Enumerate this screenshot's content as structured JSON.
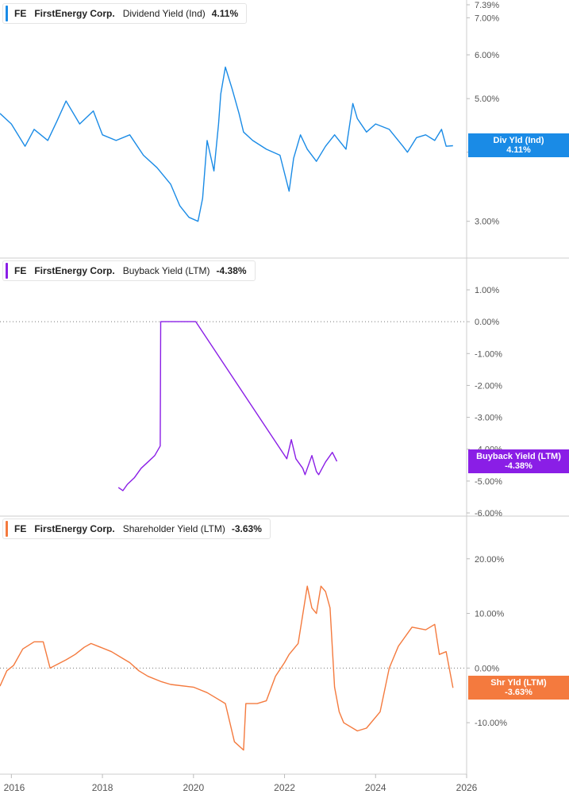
{
  "chart_data": [
    {
      "type": "line",
      "legend": {
        "ticker": "FE",
        "company": "FirstEnergy Corp.",
        "metric": "Dividend Yield (Ind)",
        "value": "4.11%"
      },
      "color": "#1a8be6",
      "badge": {
        "line1": "Div Yld (Ind)",
        "line2": "4.11%"
      },
      "scale": "log",
      "ylim": [
        2.6,
        7.39
      ],
      "yticks": [
        {
          "v": 7.39,
          "label": "7.39%"
        },
        {
          "v": 7.0,
          "label": "7.00%"
        },
        {
          "v": 6.0,
          "label": "6.00%"
        },
        {
          "v": 5.0,
          "label": "5.00%"
        },
        {
          "v": 4.0,
          "label": "4.00%"
        },
        {
          "v": 3.0,
          "label": "3.00%"
        }
      ],
      "x": [
        2015.75,
        2016.0,
        2016.3,
        2016.5,
        2016.8,
        2017.0,
        2017.2,
        2017.5,
        2017.8,
        2018.0,
        2018.3,
        2018.6,
        2018.9,
        2019.2,
        2019.5,
        2019.7,
        2019.9,
        2020.1,
        2020.2,
        2020.3,
        2020.45,
        2020.55,
        2020.6,
        2020.7,
        2020.85,
        2021.0,
        2021.1,
        2021.3,
        2021.6,
        2021.9,
        2022.1,
        2022.2,
        2022.35,
        2022.5,
        2022.7,
        2022.9,
        2023.1,
        2023.35,
        2023.5,
        2023.6,
        2023.8,
        2024.0,
        2024.3,
        2024.6,
        2024.7,
        2024.9,
        2025.1,
        2025.3,
        2025.45,
        2025.55,
        2025.7
      ],
      "y": [
        4.7,
        4.5,
        4.1,
        4.4,
        4.2,
        4.55,
        4.95,
        4.5,
        4.75,
        4.3,
        4.2,
        4.3,
        3.95,
        3.75,
        3.5,
        3.2,
        3.05,
        3.0,
        3.3,
        4.2,
        3.7,
        4.5,
        5.1,
        5.7,
        5.2,
        4.7,
        4.35,
        4.2,
        4.05,
        3.95,
        3.4,
        3.9,
        4.3,
        4.05,
        3.85,
        4.1,
        4.3,
        4.05,
        4.9,
        4.6,
        4.35,
        4.5,
        4.4,
        4.1,
        4.0,
        4.25,
        4.3,
        4.2,
        4.4,
        4.1,
        4.11
      ],
      "last_value": 4.11
    },
    {
      "type": "line",
      "legend": {
        "ticker": "FE",
        "company": "FirstEnergy Corp.",
        "metric": "Buyback Yield (LTM)",
        "value": "-4.38%"
      },
      "color": "#8a1ee6",
      "badge": {
        "line1": "Buyback Yield (LTM)",
        "line2": "-4.38%"
      },
      "scale": "linear",
      "ylim": [
        -6.0,
        1.0
      ],
      "yticks": [
        {
          "v": 1.0,
          "label": "1.00%"
        },
        {
          "v": 0.0,
          "label": "0.00%"
        },
        {
          "v": -1.0,
          "label": "-1.00%"
        },
        {
          "v": -2.0,
          "label": "-2.00%"
        },
        {
          "v": -3.0,
          "label": "-3.00%"
        },
        {
          "v": -4.0,
          "label": "-4.00%"
        },
        {
          "v": -5.0,
          "label": "-5.00%"
        },
        {
          "v": -6.0,
          "label": "-6.00%"
        }
      ],
      "zero_line": true,
      "x": [
        2018.35,
        2018.45,
        2018.55,
        2018.7,
        2018.85,
        2019.0,
        2019.15,
        2019.27,
        2019.28,
        2020.05,
        2022.05,
        2022.15,
        2022.25,
        2022.4,
        2022.45,
        2022.6,
        2022.7,
        2022.75,
        2022.9,
        2023.05,
        2023.15
      ],
      "y": [
        -5.2,
        -5.3,
        -5.1,
        -4.9,
        -4.6,
        -4.4,
        -4.2,
        -3.9,
        0.0,
        0.0,
        -4.3,
        -3.7,
        -4.3,
        -4.6,
        -4.8,
        -4.2,
        -4.7,
        -4.8,
        -4.4,
        -4.1,
        -4.38
      ],
      "last_value": -4.38
    },
    {
      "type": "line",
      "legend": {
        "ticker": "FE",
        "company": "FirstEnergy Corp.",
        "metric": "Shareholder Yield (LTM)",
        "value": "-3.63%"
      },
      "color": "#f47a3e",
      "badge": {
        "line1": "Shr Yld (LTM)",
        "line2": "-3.63%"
      },
      "scale": "linear",
      "ylim": [
        -15.5,
        22.0
      ],
      "yticks": [
        {
          "v": 20.0,
          "label": "20.00%"
        },
        {
          "v": 10.0,
          "label": "10.00%"
        },
        {
          "v": 0.0,
          "label": "0.00%"
        },
        {
          "v": -10.0,
          "label": "-10.00%"
        }
      ],
      "zero_line": true,
      "x": [
        2015.75,
        2015.9,
        2016.05,
        2016.25,
        2016.5,
        2016.7,
        2016.85,
        2017.2,
        2017.4,
        2017.6,
        2017.75,
        2017.9,
        2018.2,
        2018.4,
        2018.6,
        2018.8,
        2019.0,
        2019.3,
        2019.5,
        2020.0,
        2020.3,
        2020.5,
        2020.7,
        2020.9,
        2021.1,
        2021.15,
        2021.2,
        2021.4,
        2021.6,
        2021.8,
        2022.0,
        2022.1,
        2022.3,
        2022.5,
        2022.6,
        2022.7,
        2022.8,
        2022.9,
        2023.0,
        2023.1,
        2023.2,
        2023.3,
        2023.6,
        2023.8,
        2024.1,
        2024.3,
        2024.5,
        2024.8,
        2025.1,
        2025.3,
        2025.4,
        2025.55,
        2025.7
      ],
      "y": [
        -3.3,
        -0.5,
        0.5,
        3.5,
        4.8,
        4.8,
        0.0,
        1.5,
        2.5,
        3.8,
        4.5,
        4.0,
        3.0,
        2.0,
        1.0,
        -0.5,
        -1.5,
        -2.5,
        -3.0,
        -3.5,
        -4.5,
        -5.5,
        -6.5,
        -13.5,
        -15.0,
        -6.5,
        -6.5,
        -6.5,
        -6.0,
        -1.5,
        1.0,
        2.5,
        4.5,
        15.0,
        11.0,
        10.0,
        15.0,
        14.0,
        11.0,
        -3.5,
        -8.0,
        -10.0,
        -11.5,
        -11.0,
        -8.0,
        0.0,
        4.0,
        7.5,
        7.0,
        8.0,
        2.5,
        3.0,
        -3.63
      ],
      "last_value": -3.63
    }
  ],
  "x_axis": {
    "range": [
      2015.75,
      2026.0
    ],
    "ticks": [
      {
        "v": 2016,
        "label": "2016"
      },
      {
        "v": 2018,
        "label": "2018"
      },
      {
        "v": 2020,
        "label": "2020"
      },
      {
        "v": 2022,
        "label": "2022"
      },
      {
        "v": 2024,
        "label": "2024"
      },
      {
        "v": 2026,
        "label": "2026"
      }
    ]
  }
}
